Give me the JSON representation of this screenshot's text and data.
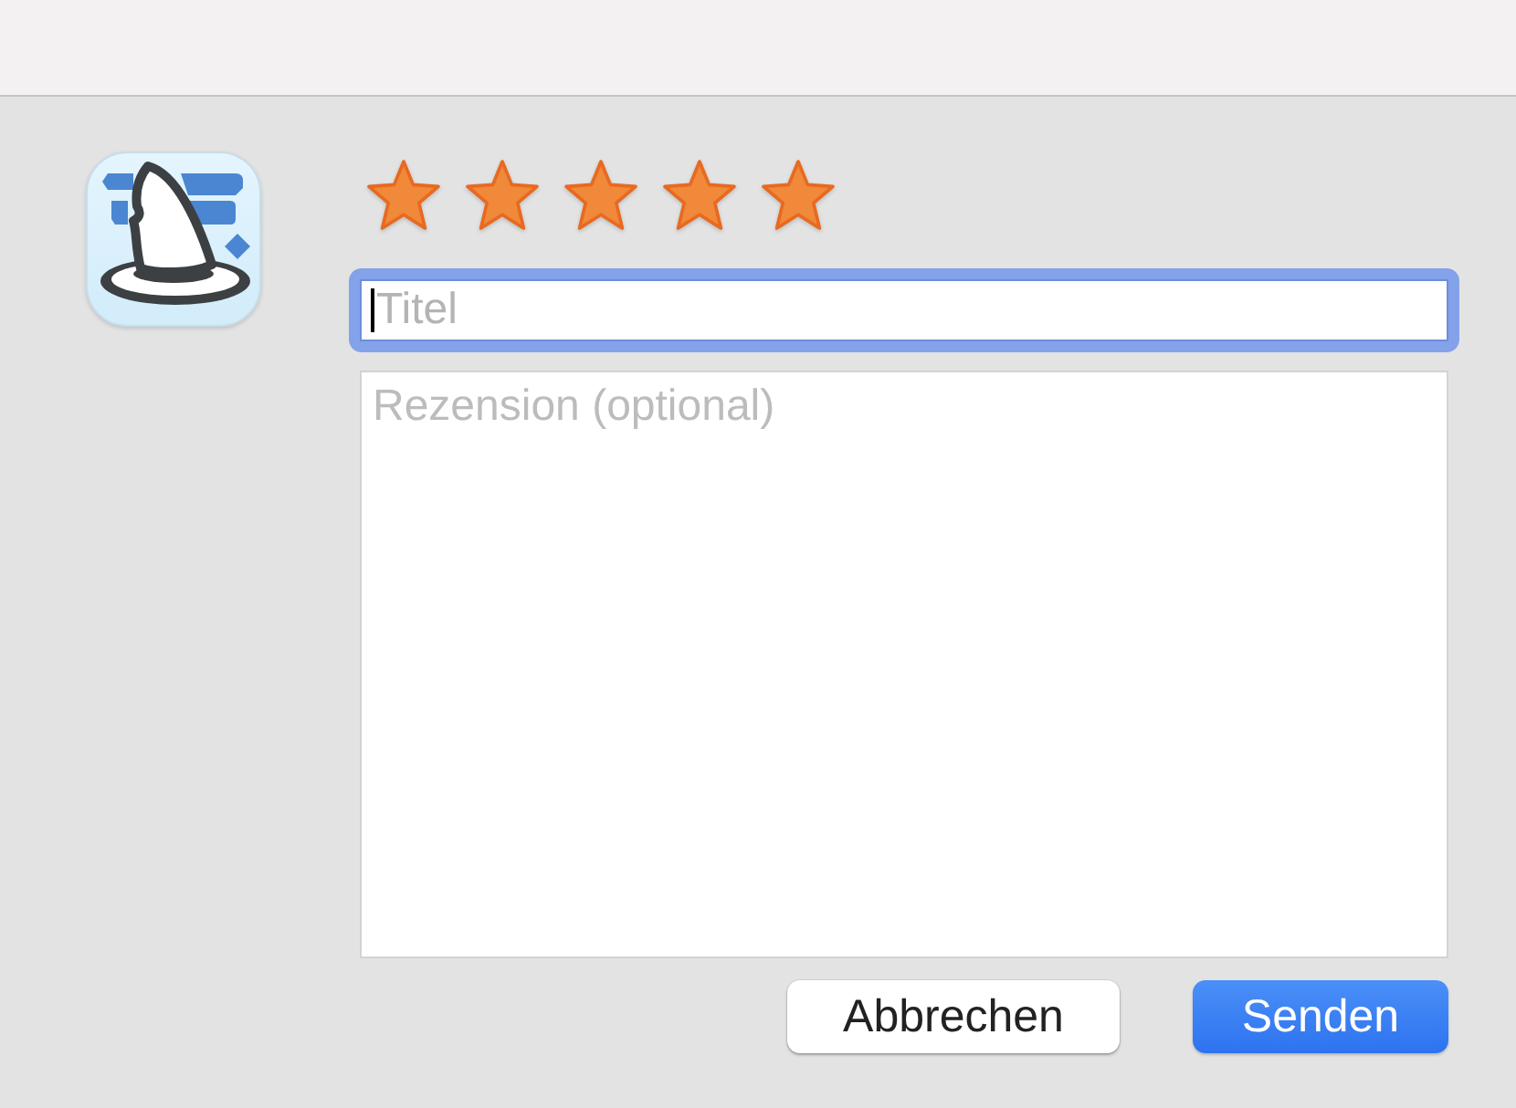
{
  "rating": {
    "stars": 5
  },
  "title_field": {
    "placeholder": "Titel",
    "focused": true
  },
  "review_field": {
    "placeholder": "Rezension (optional)"
  },
  "buttons": [
    {
      "label": "Abbrechen",
      "kind": "secondary"
    },
    {
      "label": "Senden",
      "kind": "primary"
    }
  ]
}
